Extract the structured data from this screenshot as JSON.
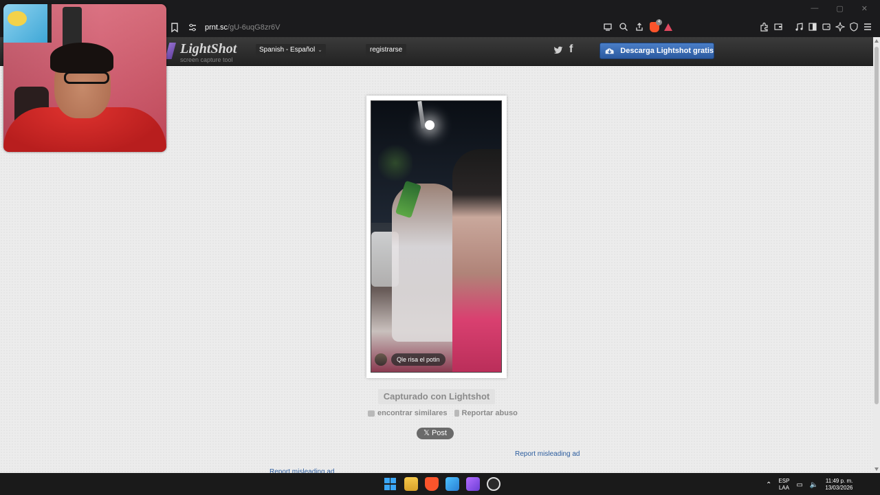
{
  "browser": {
    "url_host": "prnt.sc",
    "url_path": "/gU-6uqG8zr6V",
    "window_controls": [
      "—",
      "▢",
      "✕"
    ]
  },
  "lightshot": {
    "logo_title": "LightShot",
    "logo_subtitle": "screen capture tool",
    "language": "Spanish - Español",
    "language_caret": "⌄",
    "register": "registrarse",
    "facebook_glyph": "f",
    "download_button": "Descarga Lightshot gratis"
  },
  "screenshot": {
    "caption": "Qle risa el potin"
  },
  "page": {
    "captured_with": "Capturado con Lightshot",
    "find_similar": "encontrar similares",
    "report_abuse": "Reportar abuso",
    "post_button": "𝕏 Post",
    "report_ad_1": "Report misleading ad",
    "report_ad_2": "Report misleading ad"
  },
  "taskbar": {
    "lang_line1": "ESP",
    "lang_line2": "LAA",
    "time": "11:49 p. m.",
    "date": "13/03/2026"
  },
  "colors": {
    "download_button": "#2b5aa0",
    "link": "#2b5c9e",
    "page_bg": "#ececec"
  }
}
